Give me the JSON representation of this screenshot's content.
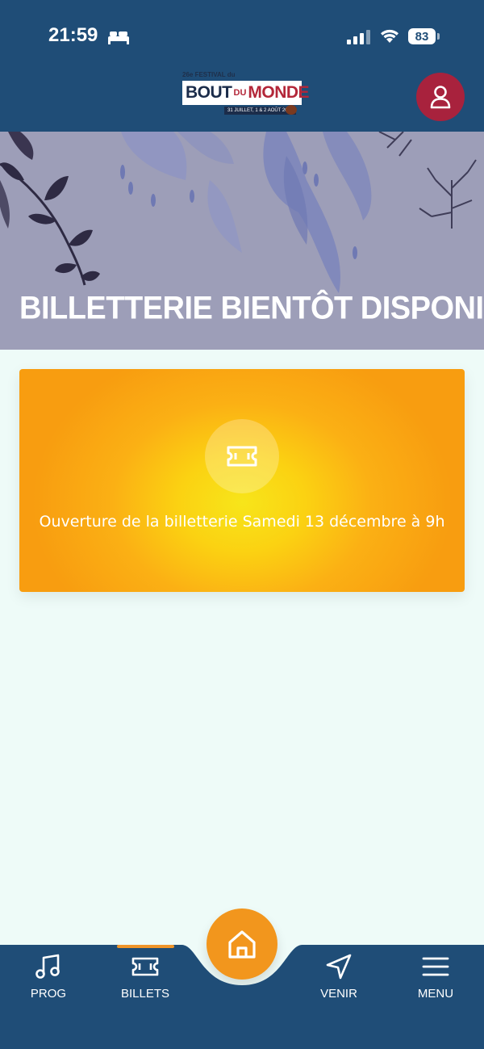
{
  "status_bar": {
    "time": "21:59",
    "battery": "83",
    "icons": [
      "bed-icon",
      "signal-icon",
      "wifi-icon",
      "battery-icon"
    ]
  },
  "header": {
    "logo": {
      "small_text": "26e FESTIVAL du",
      "word1": "BOUT",
      "word2": "DU",
      "word3": "MONDE",
      "dates": "31 JUILLET, 1 & 2 AOÛT 2026"
    },
    "profile_icon": "user-icon",
    "colors": {
      "background": "#1f4d77",
      "profile": "#a8223d"
    }
  },
  "hero": {
    "title": "BILLETTERIE BIENTÔT DISPONIBLE",
    "background": "#9d9eb8"
  },
  "card": {
    "icon": "ticket-icon",
    "text": "Ouverture de la billetterie Samedi 13 décembre à 9h",
    "colors": [
      "#f7e51a",
      "#fbb014",
      "#f89d10"
    ]
  },
  "bottom_nav": {
    "items": [
      {
        "label": "PROG",
        "icon": "music-note-icon"
      },
      {
        "label": "BILLETS",
        "icon": "ticket-icon",
        "active": true
      },
      {
        "label": "VENIR",
        "icon": "navigation-arrow-icon"
      },
      {
        "label": "MENU",
        "icon": "hamburger-menu-icon"
      }
    ],
    "home_icon": "home-icon",
    "colors": {
      "background": "#1f4d77",
      "accent": "#f2961d"
    }
  }
}
